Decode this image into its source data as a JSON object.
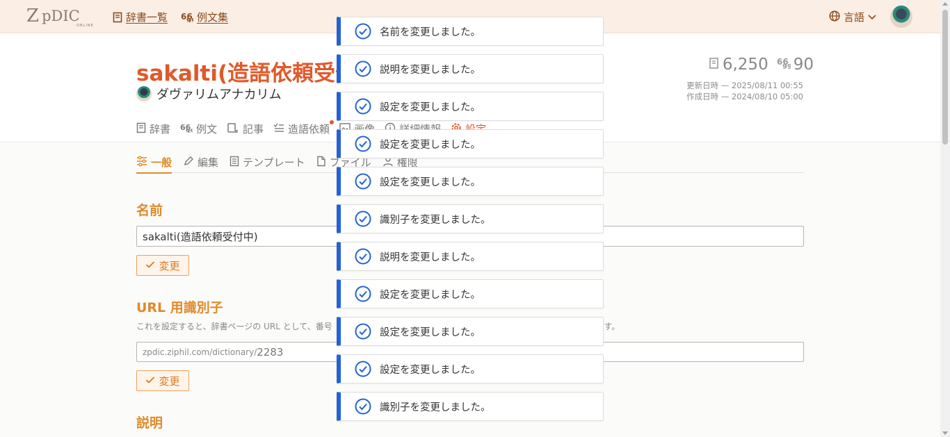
{
  "app": {
    "logo_mark": "Z",
    "logo_text": "pDIC",
    "logo_sub": "ONLINE",
    "nav": [
      {
        "label": "辞書一覧"
      },
      {
        "label": "例文集"
      }
    ],
    "language_label": "言語"
  },
  "dictionary": {
    "title": "sakalti(造語依頼受付",
    "owner": "ダヴァリムアナカリム",
    "word_count": "6,250",
    "example_count": "90",
    "updated": "更新日時 — 2025/08/11 00:55",
    "created": "作成日時 — 2024/08/10 05:00",
    "tabs": [
      {
        "label": "辞書"
      },
      {
        "label": "例文"
      },
      {
        "label": "記事"
      },
      {
        "label": "造語依頼"
      },
      {
        "label": "画像"
      },
      {
        "label": "詳細情報"
      },
      {
        "label": "設定"
      }
    ]
  },
  "settings": {
    "subtabs": [
      {
        "label": "一般"
      },
      {
        "label": "編集"
      },
      {
        "label": "テンプレート"
      },
      {
        "label": "ファイル"
      },
      {
        "label": "権限"
      }
    ],
    "name_heading": "名前",
    "name_value": "sakalti(造語依頼受付中)",
    "change_label": "変更",
    "url_heading": "URL 用識別子",
    "url_description_left": "これを設定すると、辞書ページの URL として、番号",
    "url_description_right": "す。",
    "url_prefix": "zpdic.ziphil.com/dictionary/",
    "url_value": "2283",
    "description_heading": "説明"
  },
  "toasts": [
    {
      "message": "名前を変更しました。"
    },
    {
      "message": "説明を変更しました。"
    },
    {
      "message": "設定を変更しました。"
    },
    {
      "message": "設定を変更しました。"
    },
    {
      "message": "設定を変更しました。"
    },
    {
      "message": "識別子を変更しました。"
    },
    {
      "message": "説明を変更しました。"
    },
    {
      "message": "設定を変更しました。"
    },
    {
      "message": "設定を変更しました。"
    },
    {
      "message": "設定を変更しました。"
    },
    {
      "message": "識別子を変更しました。"
    }
  ],
  "colors": {
    "brand": "#e0592a",
    "accent": "#e08a2a",
    "toast_accent": "#2262d6",
    "topbar_bg": "#fbeee4"
  },
  "icons": [
    "book-icon",
    "quote-icon",
    "globe-icon",
    "chevron-down-icon",
    "article-icon",
    "request-icon",
    "image-icon",
    "info-icon",
    "gear-icon",
    "sliders-icon",
    "pencil-icon",
    "template-icon",
    "file-icon",
    "permission-icon",
    "check-icon",
    "check-circle-icon"
  ]
}
